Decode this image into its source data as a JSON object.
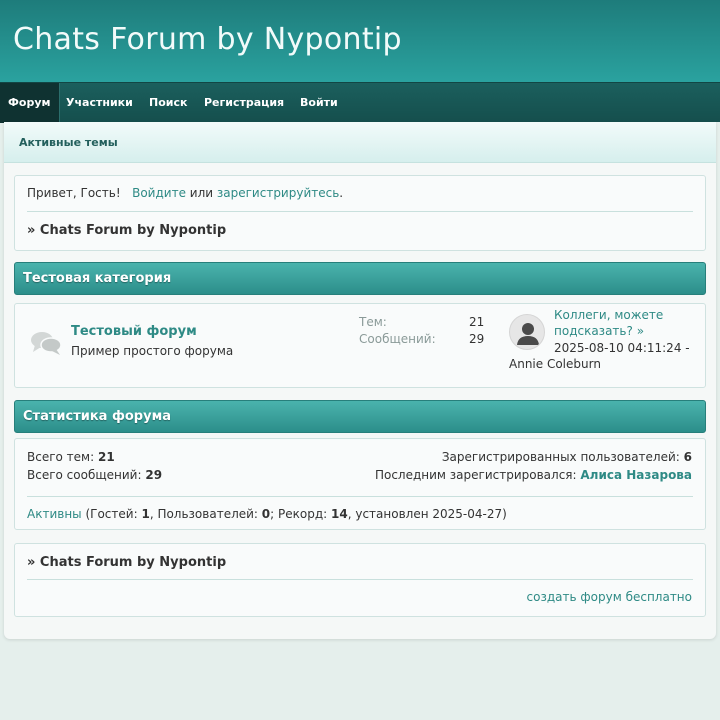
{
  "header": {
    "title": "Chats Forum by Nypontip"
  },
  "nav": {
    "items": [
      "Форум",
      "Участники",
      "Поиск",
      "Регистрация",
      "Войти"
    ]
  },
  "subnav": {
    "active_topics": "Активные темы"
  },
  "welcome": {
    "greeting": "Привет, Гость!",
    "login": "Войдите",
    "or": "или",
    "register": "зарегистрируйтесь",
    "period": ".",
    "breadcrumb": "» Chats Forum by Nypontip"
  },
  "category": {
    "title": "Тестовая категория",
    "forum": {
      "name": "Тестовый форум",
      "description": "Пример простого форума",
      "topics_label": "Тем:",
      "topics_value": "21",
      "posts_label": "Сообщений:",
      "posts_value": "29",
      "last_post_title_line1": "Коллеги, можете",
      "last_post_title_line2": "подсказать?",
      "last_post_arrow": "»",
      "last_post_date": "2025-08-10 04:11:24 -",
      "last_post_author": "Annie Coleburn"
    }
  },
  "stats": {
    "title": "Статистика форума",
    "total_topics_label": "Всего тем:",
    "total_topics_value": "21",
    "total_posts_label": "Всего сообщений:",
    "total_posts_value": "29",
    "registered_label": "Зарегистрированных пользователей:",
    "registered_value": "6",
    "last_registered_label": "Последним зарегистрировался:",
    "last_registered_value": "Алиса Назарова",
    "online_link": "Активны",
    "online_part1": "(Гостей:",
    "guests": "1",
    "online_part2": ", Пользователей:",
    "users": "0",
    "online_part3": "; Рекорд:",
    "record": "14",
    "online_part4": ", установлен 2025-04-27)"
  },
  "footer": {
    "breadcrumb": "» Chats Forum by Nypontip",
    "create_link": "создать форум бесплатно"
  },
  "colors": {
    "accent": "#2e8a85",
    "header": "#2aa29f",
    "nav": "#154f4d"
  },
  "icons": [
    "forum-bubbles-icon",
    "user-avatar-icon"
  ]
}
